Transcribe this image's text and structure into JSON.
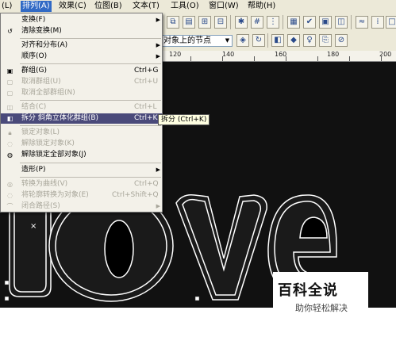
{
  "menubar": {
    "items": [
      "(L)",
      "排列(A)",
      "效果(C)",
      "位图(B)",
      "文本(T)",
      "工具(O)",
      "窗口(W)",
      "帮助(H)"
    ]
  },
  "toolbar2": {
    "snap_value": "对象上的节点"
  },
  "ruler": {
    "labels": [
      "120",
      "140",
      "160",
      "180",
      "200"
    ]
  },
  "menu": {
    "items": [
      {
        "label": "变换(F)",
        "shortcut": "",
        "submenu": true,
        "disabled": false,
        "icon": ""
      },
      {
        "label": "清除变换(M)",
        "shortcut": "",
        "submenu": false,
        "disabled": false,
        "icon": "clear-transform-icon"
      },
      {
        "label": "对齐和分布(A)",
        "shortcut": "",
        "submenu": true,
        "disabled": false,
        "icon": ""
      },
      {
        "label": "顺序(O)",
        "shortcut": "",
        "submenu": true,
        "disabled": false,
        "icon": ""
      },
      {
        "label": "群组(G)",
        "shortcut": "Ctrl+G",
        "submenu": false,
        "disabled": false,
        "icon": "group-icon"
      },
      {
        "label": "取消群组(U)",
        "shortcut": "Ctrl+U",
        "submenu": false,
        "disabled": true,
        "icon": "ungroup-icon"
      },
      {
        "label": "取消全部群组(N)",
        "shortcut": "",
        "submenu": false,
        "disabled": true,
        "icon": "ungroup-all-icon"
      },
      {
        "label": "结合(C)",
        "shortcut": "Ctrl+L",
        "submenu": false,
        "disabled": true,
        "icon": "combine-icon"
      },
      {
        "label": "拆分 斜角立体化群组(B)",
        "shortcut": "Ctrl+K",
        "submenu": false,
        "disabled": false,
        "icon": "break-apart-icon",
        "highlighted": true
      },
      {
        "label": "锁定对象(L)",
        "shortcut": "",
        "submenu": false,
        "disabled": true,
        "icon": "lock-icon"
      },
      {
        "label": "解除锁定对象(K)",
        "shortcut": "",
        "submenu": false,
        "disabled": true,
        "icon": "unlock-icon"
      },
      {
        "label": "解除锁定全部对象(J)",
        "shortcut": "",
        "submenu": false,
        "disabled": false,
        "icon": "unlock-all-icon"
      },
      {
        "label": "造形(P)",
        "shortcut": "",
        "submenu": true,
        "disabled": false,
        "icon": ""
      },
      {
        "label": "转换为曲线(V)",
        "shortcut": "Ctrl+Q",
        "submenu": false,
        "disabled": true,
        "icon": "convert-curves-icon"
      },
      {
        "label": "将轮廓转换为对象(E)",
        "shortcut": "Ctrl+Shift+Q",
        "submenu": false,
        "disabled": true,
        "icon": "outline-to-object-icon"
      },
      {
        "label": "闭合路径(S)",
        "shortcut": "",
        "submenu": true,
        "disabled": true,
        "icon": "close-path-icon"
      }
    ]
  },
  "tooltip": "拆分 (Ctrl+K)",
  "canvas": {
    "text": "love"
  },
  "watermark": {
    "title": "百科全说",
    "subtitle": "助你轻松解决"
  },
  "colors": {
    "menu_highlight": "#4a4a7a",
    "menubar_active": "#316ac5",
    "canvas_bg": "#111111"
  }
}
